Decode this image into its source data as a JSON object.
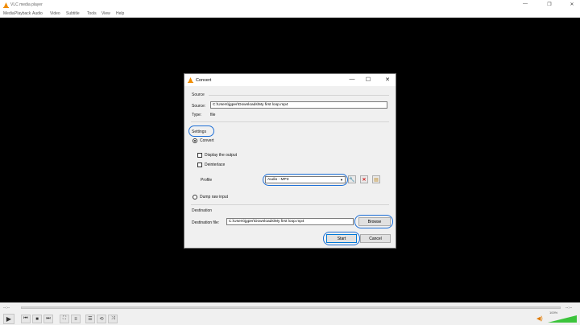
{
  "app": {
    "title": "VLC media player"
  },
  "window_controls": {
    "minimize": "—",
    "maximize": "❐",
    "close": "✕"
  },
  "menu": [
    "Media",
    "Playback",
    "Audio",
    "Video",
    "Subtitle",
    "Tools",
    "View",
    "Help"
  ],
  "player": {
    "time_elapsed": "--:--",
    "time_total": "--:--",
    "volume": "100%",
    "volume_level": 1.0
  },
  "dialog": {
    "title": "Convert",
    "controls": {
      "minimize": "—",
      "maximize": "☐",
      "close": "✕"
    },
    "source": {
      "section_label": "Source",
      "source_label": "Source:",
      "source_value": "C:\\Users\\jgper\\Downloads\\My first loop.mp4",
      "type_label": "Type:",
      "type_value": "file"
    },
    "settings": {
      "section_label": "Settings",
      "convert_label": "Convert",
      "display_output_label": "Display the output",
      "deinterlace_label": "Deinterlace",
      "profile_label": "Profile",
      "profile_value": "Audio - MP3",
      "dump_label": "Dump raw input"
    },
    "destination": {
      "section_label": "Destination",
      "file_label": "Destination file:",
      "file_value": "C:\\Users\\jgper\\Downloads\\My first loop.mp4",
      "browse_label": "Browse"
    },
    "buttons": {
      "start": "Start",
      "cancel": "Cancel"
    }
  },
  "colors": {
    "highlight": "#1e6fd6",
    "vlc_orange": "#f08c00",
    "volume_green": "#3cc43c"
  }
}
